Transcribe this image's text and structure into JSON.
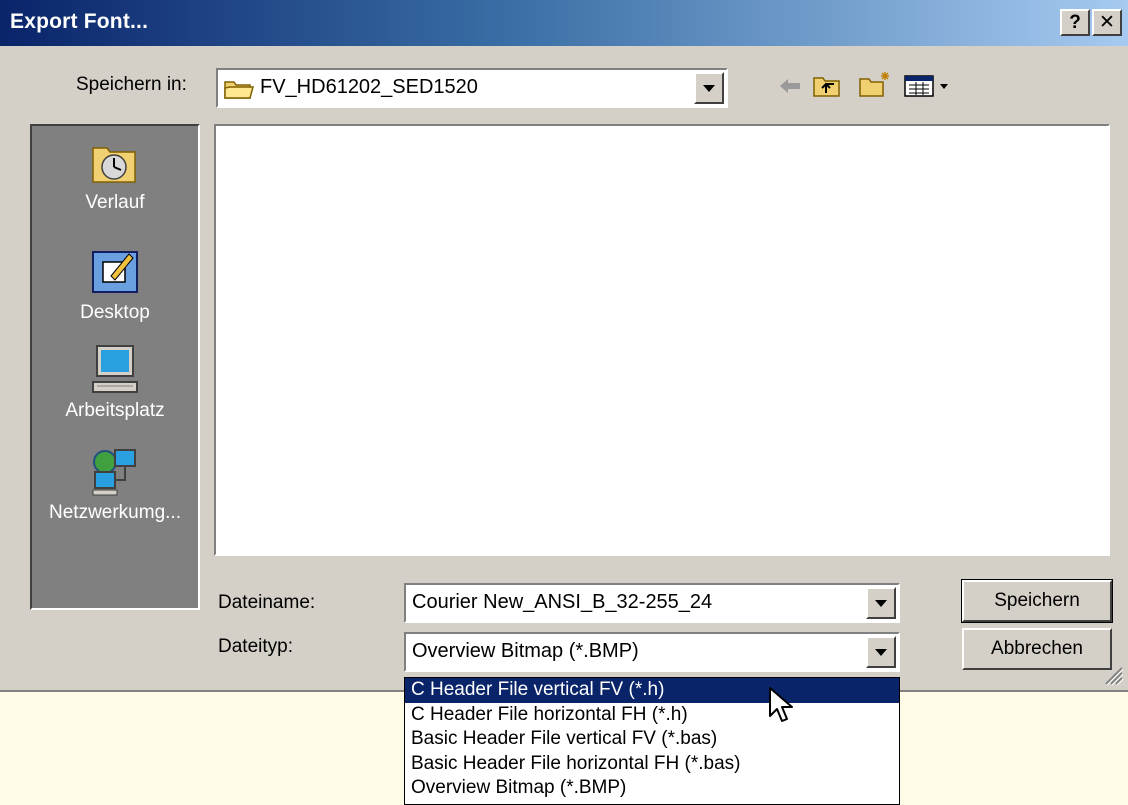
{
  "dialog": {
    "title": "Export Font...",
    "help_label": "?",
    "close_label": "✕"
  },
  "save_in": {
    "label": "Speichern in:",
    "value": "FV_HD61202_SED1520"
  },
  "toolbar": {
    "icons": [
      "back-arrow-icon",
      "up-folder-icon",
      "new-folder-icon",
      "view-menu-icon"
    ]
  },
  "places": [
    {
      "label": "Verlauf",
      "icon": "history-icon"
    },
    {
      "label": "Desktop",
      "icon": "desktop-icon"
    },
    {
      "label": "Arbeitsplatz",
      "icon": "my-computer-icon"
    },
    {
      "label": "Netzwerkumg...",
      "icon": "network-icon"
    }
  ],
  "filename": {
    "label": "Dateiname:",
    "value": "Courier New_ANSI_B_32-255_24"
  },
  "filetype": {
    "label": "Dateityp:",
    "value": "Overview Bitmap (*.BMP)",
    "options": [
      "C Header File vertical FV (*.h)",
      "C Header File horizontal FH (*.h)",
      "Basic Header File vertical FV (*.bas)",
      "Basic Header File horizontal FH (*.bas)",
      "Overview Bitmap (*.BMP)"
    ],
    "highlighted_index": 0
  },
  "buttons": {
    "save": "Speichern",
    "cancel": "Abbrechen"
  },
  "colors": {
    "title_start": "#0a246a",
    "title_end": "#a6caf0",
    "face": "#d4d0c8",
    "selection": "#0a246a",
    "below_dialog": "#fffbe6"
  }
}
